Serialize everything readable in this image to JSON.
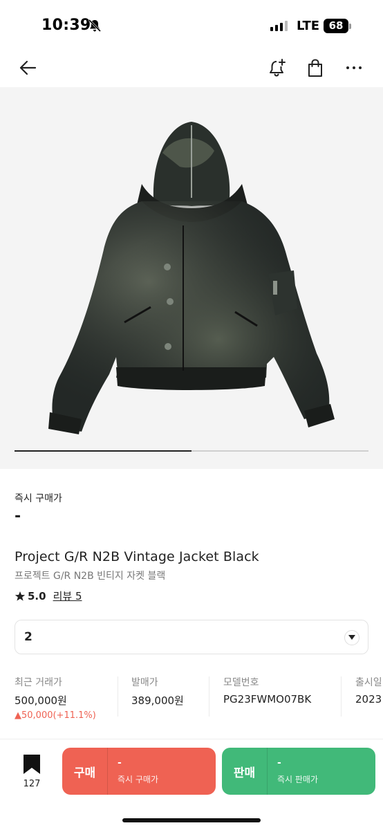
{
  "status_bar": {
    "time": "10:39",
    "network": "LTE",
    "battery": "68"
  },
  "nav": {
    "back_icon": "arrow-left-icon",
    "icons": [
      "bell-plus-icon",
      "shopping-bag-icon",
      "more-horizontal-icon"
    ]
  },
  "product": {
    "image_indicator": {
      "current": 1,
      "total": 2
    },
    "instant_price_label": "즉시 구매가",
    "instant_price_value": "-",
    "name_en": "Project G/R N2B Vintage Jacket Black",
    "name_ko": "프로젝트 G/R N2B 빈티지 자켓 블랙",
    "rating": "5.0",
    "review_label": "리뷰 5",
    "size": "2"
  },
  "info": [
    {
      "label": "최근 거래가",
      "value": "500,000원",
      "change": "▲50,000(+11.1%)"
    },
    {
      "label": "발매가",
      "value": "389,000원"
    },
    {
      "label": "모델번호",
      "value": "PG23FWMO07BK"
    },
    {
      "label": "출시일",
      "value": "2023"
    }
  ],
  "bottom": {
    "bookmark_count": "127",
    "buy": {
      "title": "구매",
      "price": "-",
      "sub": "즉시 구매가"
    },
    "sell": {
      "title": "판매",
      "price": "-",
      "sub": "즉시 판매가"
    }
  },
  "colors": {
    "buy": "#ef6253",
    "sell": "#41b979",
    "price_up": "#ef6253"
  }
}
